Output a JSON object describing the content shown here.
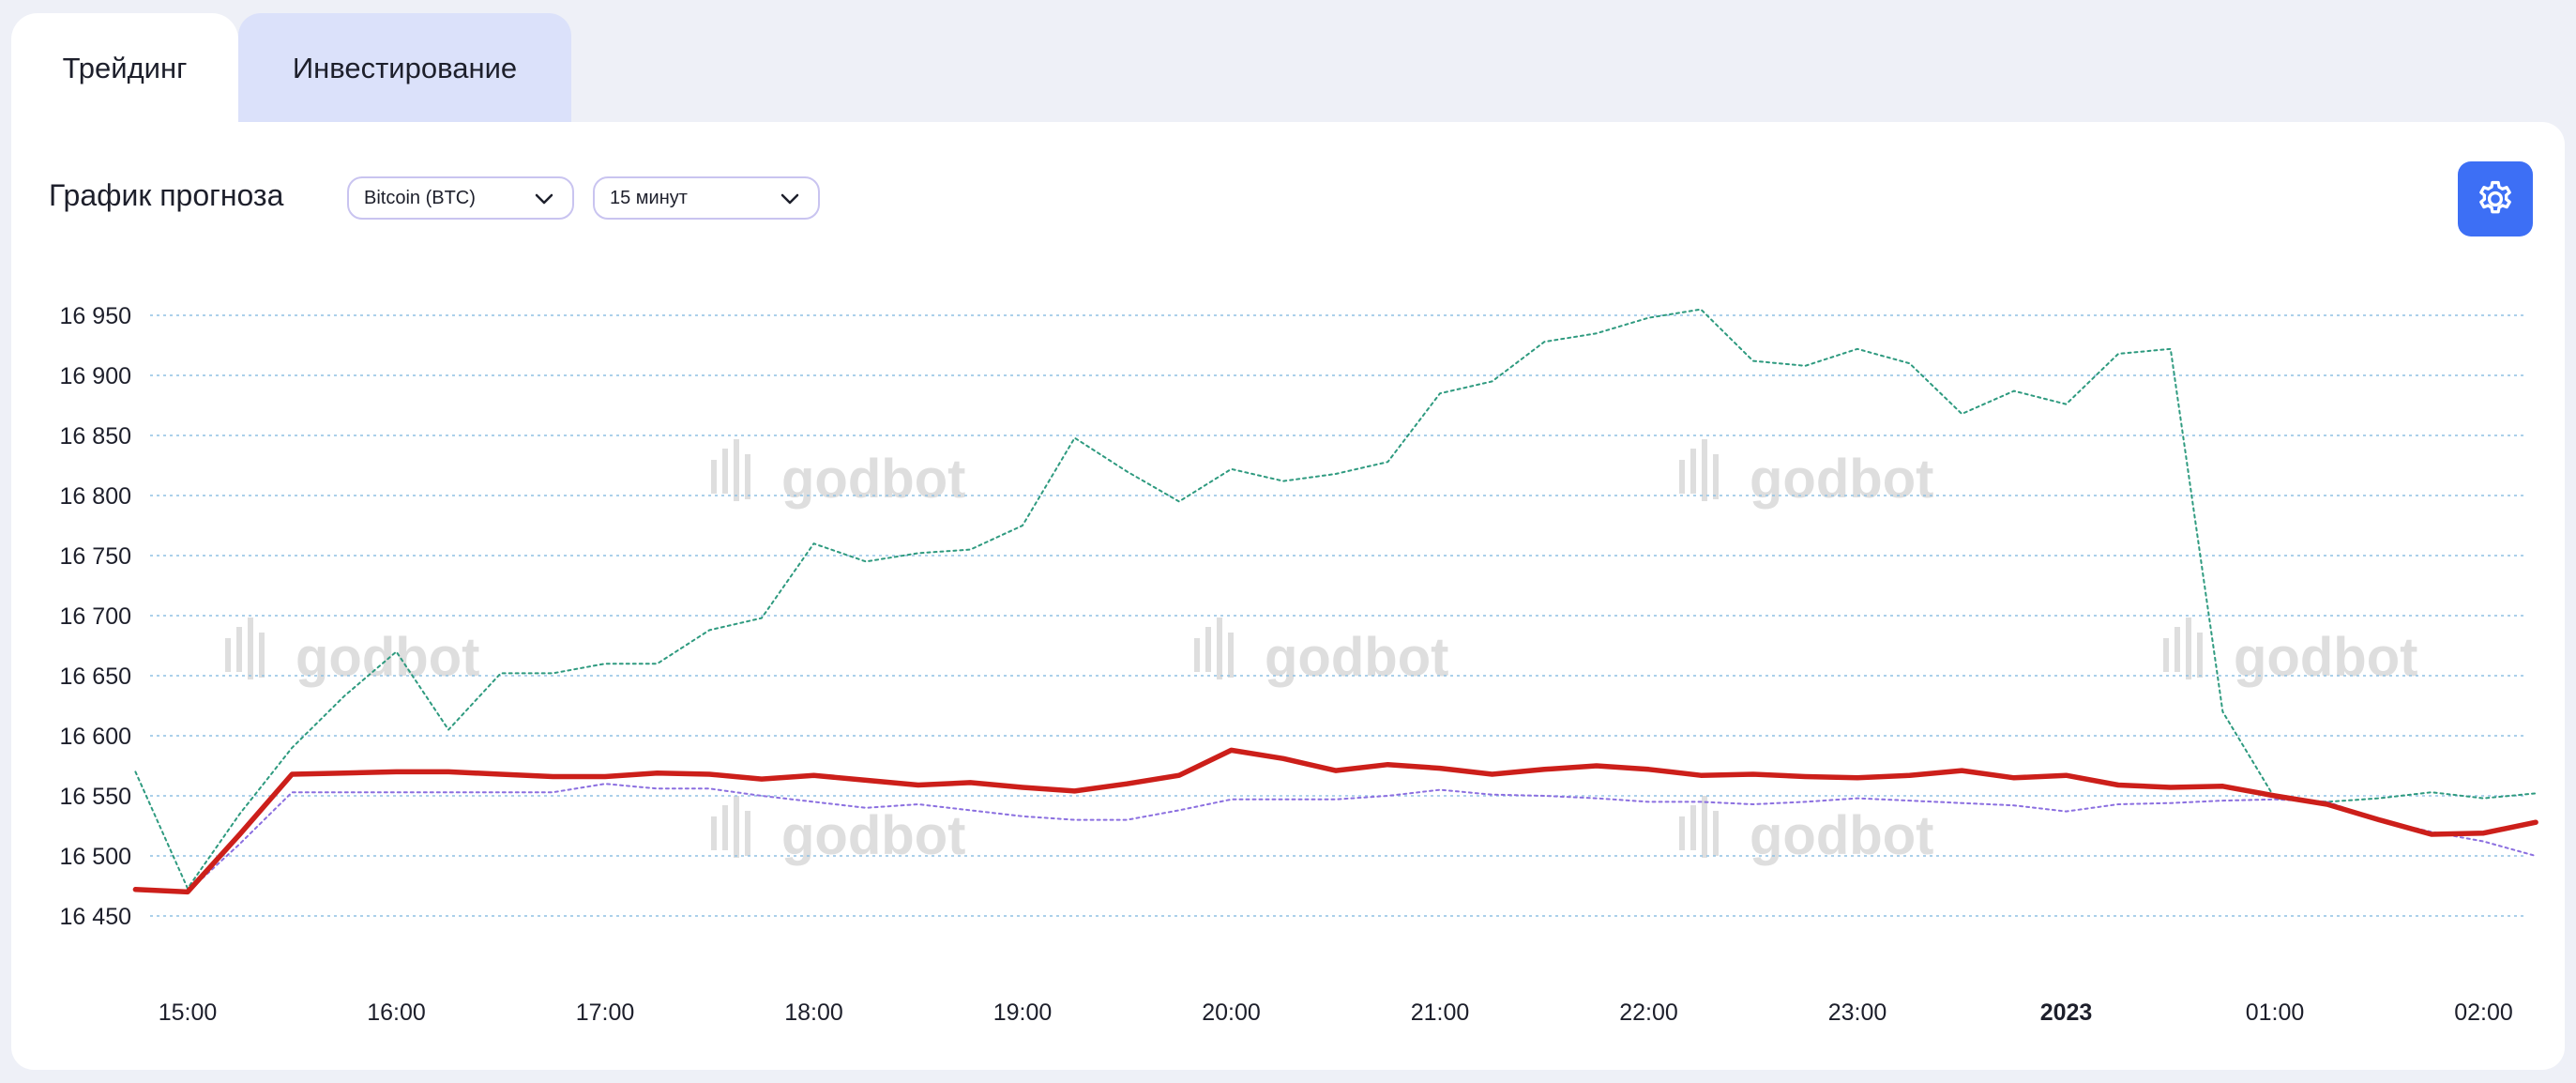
{
  "tabs": [
    {
      "label": "Трейдинг",
      "active": true
    },
    {
      "label": "Инвестирование",
      "active": false
    }
  ],
  "header": {
    "title": "График прогноза",
    "coin_select": "Bitcoin (BTC)",
    "interval_select": "15 минут",
    "settings_icon": "gear-icon"
  },
  "watermark": "godbot",
  "colors": {
    "accent": "#3d6ff5",
    "tab_inactive": "#dbe1fa",
    "actual_line": "#cc1f1a",
    "green_line": "#2e9a7f",
    "purple_line": "#8b6fe0",
    "grid": "#8fc1e3"
  },
  "chart_data": {
    "type": "line",
    "title": "",
    "xlabel": "",
    "ylabel": "",
    "ylim": [
      16420,
      16975
    ],
    "y_ticks": [
      16950,
      16900,
      16850,
      16800,
      16750,
      16700,
      16650,
      16600,
      16550,
      16500,
      16450
    ],
    "y_tick_labels": [
      "16 950",
      "16 900",
      "16 850",
      "16 800",
      "16 750",
      "16 700",
      "16 650",
      "16 600",
      "16 550",
      "16 500",
      "16 450"
    ],
    "x_ticks": [
      "15:00",
      "16:00",
      "17:00",
      "18:00",
      "19:00",
      "20:00",
      "21:00",
      "22:00",
      "23:00",
      "2023",
      "01:00",
      "02:00"
    ],
    "x_bold_ticks": [
      "2023"
    ],
    "x_axis": "hours relative to 00:00 (2023-01-01); each step is 15 minutes",
    "x": [
      -9.25,
      -9.0,
      -8.75,
      -8.5,
      -8.25,
      -8.0,
      -7.75,
      -7.5,
      -7.25,
      -7.0,
      -6.75,
      -6.5,
      -6.25,
      -6.0,
      -5.75,
      -5.5,
      -5.25,
      -5.0,
      -4.75,
      -4.5,
      -4.25,
      -4.0,
      -3.75,
      -3.5,
      -3.25,
      -3.0,
      -2.75,
      -2.5,
      -2.25,
      -2.0,
      -1.75,
      -1.5,
      -1.25,
      -1.0,
      -0.75,
      -0.5,
      -0.25,
      0.0,
      0.25,
      0.5,
      0.75,
      1.0,
      1.25,
      1.5,
      1.75,
      2.0,
      2.25
    ],
    "grid": true,
    "series": [
      {
        "key": "green",
        "style": "dotted",
        "values": [
          16570,
          16473,
          16535,
          16590,
          16633,
          16670,
          16605,
          16652,
          16652,
          16660,
          16660,
          16688,
          16698,
          16760,
          16745,
          16752,
          16755,
          16775,
          16848,
          16820,
          16795,
          16822,
          16812,
          16818,
          16828,
          16885,
          16895,
          16928,
          16935,
          16948,
          16955,
          16912,
          16908,
          16922,
          16910,
          16868,
          16887,
          16876,
          16918,
          16922,
          16620,
          16548,
          16545,
          16548,
          16553,
          16548,
          16552
        ]
      },
      {
        "key": "purple",
        "style": "dotted",
        "values": [
          16471,
          16470,
          16510,
          16553,
          16553,
          16553,
          16553,
          16553,
          16553,
          16560,
          16556,
          16556,
          16550,
          16545,
          16540,
          16543,
          16538,
          16533,
          16530,
          16530,
          16538,
          16547,
          16547,
          16547,
          16550,
          16555,
          16551,
          16550,
          16548,
          16545,
          16545,
          16543,
          16545,
          16548,
          16546,
          16544,
          16542,
          16537,
          16543,
          16544,
          16546,
          16547,
          16545,
          16530,
          16520,
          16512,
          16500
        ]
      },
      {
        "key": "actual",
        "style": "solid",
        "values": [
          16472,
          16470,
          16518,
          16568,
          16569,
          16570,
          16570,
          16568,
          16566,
          16566,
          16569,
          16568,
          16564,
          16567,
          16563,
          16559,
          16561,
          16557,
          16554,
          16560,
          16567,
          16588,
          16581,
          16571,
          16576,
          16573,
          16568,
          16572,
          16575,
          16572,
          16567,
          16568,
          16566,
          16565,
          16567,
          16571,
          16565,
          16567,
          16559,
          16557,
          16558,
          16550,
          16543,
          16530,
          16518,
          16519,
          16528
        ]
      }
    ]
  }
}
